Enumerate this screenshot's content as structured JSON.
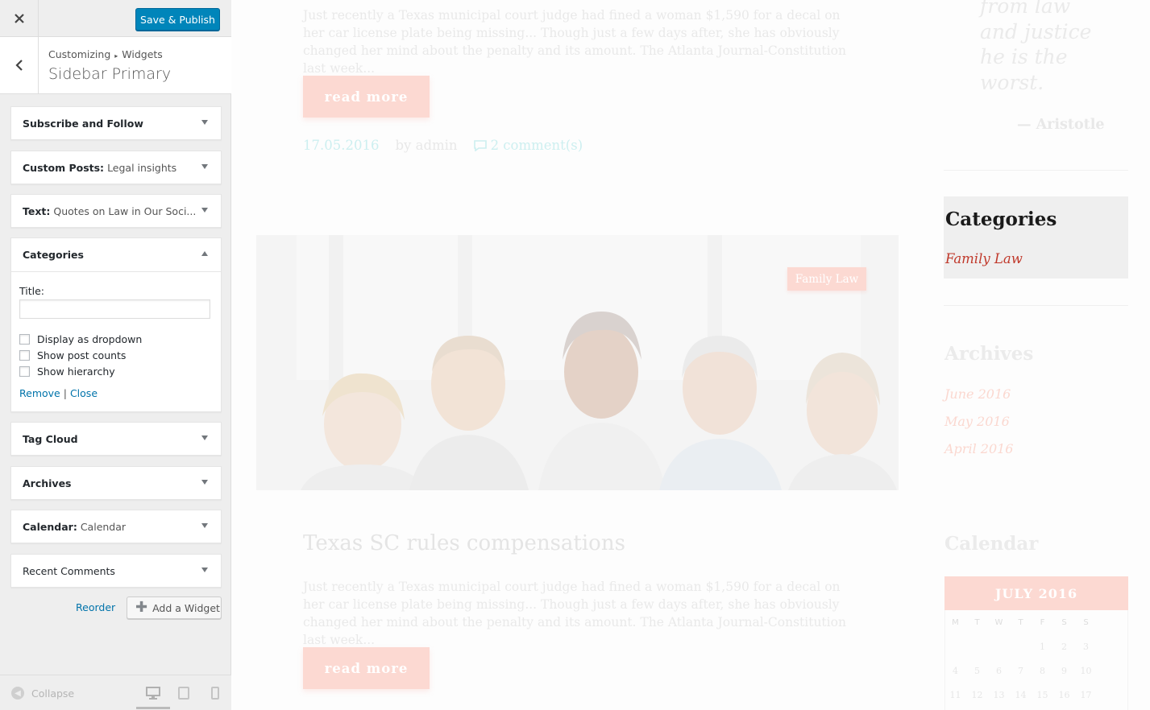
{
  "customizer": {
    "save_publish": "Save & Publish",
    "breadcrumb": [
      "Customizing",
      "Widgets"
    ],
    "section_title": "Sidebar Primary",
    "widgets": [
      {
        "title": "Subscribe and Follow",
        "subtitle": ""
      },
      {
        "title": "Custom Posts:",
        "subtitle": "Legal insights"
      },
      {
        "title": "Text:",
        "subtitle": "Quotes on Law in Our Soci..."
      },
      {
        "title": "Categories",
        "subtitle": ""
      },
      {
        "title": "Tag Cloud",
        "subtitle": ""
      },
      {
        "title": "Archives",
        "subtitle": ""
      },
      {
        "title": "Calendar:",
        "subtitle": "Calendar"
      },
      {
        "title": "Recent Comments",
        "subtitle": ""
      }
    ],
    "categories_form": {
      "title_label": "Title:",
      "title_value": "",
      "options": [
        "Display as dropdown",
        "Show post counts",
        "Show hierarchy"
      ],
      "remove": "Remove",
      "separator": "|",
      "close": "Close"
    },
    "reorder": "Reorder",
    "add_widget": "Add a Widget",
    "collapse": "Collapse",
    "devices": [
      "desktop-icon",
      "tablet-icon",
      "mobile-icon"
    ]
  },
  "preview": {
    "post1": {
      "excerpt": "Just recently a Texas municipal court judge had fined a woman $1,590 for a decal on her car license plate being missing... Though just a few days after, she has obviously changed her mind about the penalty and its amount. The Atlanta Journal-Constitution last week...",
      "read_more": "read more",
      "date": "17.05.2016",
      "author": "by admin",
      "comments": "2 comment(s)"
    },
    "post2": {
      "badge": "Family Law",
      "title": "Texas SC rules compensations",
      "excerpt": "Just recently a Texas municipal court judge had fined a woman $1,590 for a decal on her car license plate being missing... Though just a few days after, she has obviously changed her mind about the penalty and its amount. The Atlanta Journal-Constitution last week...",
      "read_more": "read more"
    },
    "sidebar": {
      "quote_lines": [
        "from law",
        "and justice",
        "he is the",
        "worst."
      ],
      "quote_author": "— Aristotle",
      "categories_title": "Categories",
      "categories": [
        "Family Law"
      ],
      "archives_title": "Archives",
      "archives": [
        "June 2016",
        "May 2016",
        "April 2016"
      ],
      "calendar_title": "Calendar",
      "calendar_month": "JULY 2016",
      "calendar_days": [
        "M",
        "T",
        "W",
        "T",
        "F",
        "S",
        "S"
      ],
      "calendar_weeks": [
        [
          "",
          "",
          "",
          "",
          "1",
          "2",
          "3"
        ],
        [
          "4",
          "5",
          "6",
          "7",
          "8",
          "9",
          "10"
        ],
        [
          "11",
          "12",
          "13",
          "14",
          "15",
          "16",
          "17"
        ]
      ]
    }
  },
  "colors": {
    "accent_blue": "#0085ba",
    "link_blue": "#0073aa",
    "category_red": "#c0392b",
    "button_pink": "#fcd9d2"
  }
}
